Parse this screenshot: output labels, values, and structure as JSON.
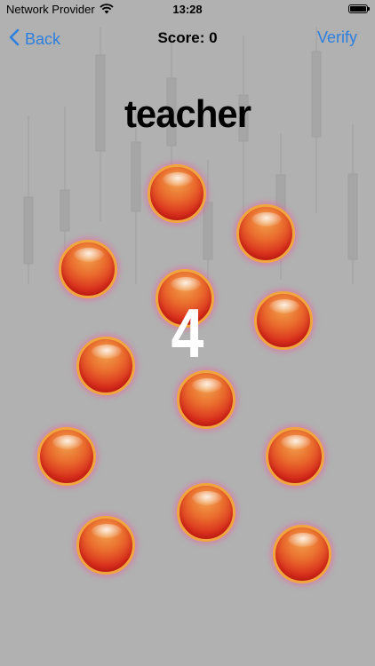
{
  "status_bar": {
    "carrier": "Network Provider",
    "time": "13:28",
    "wifi_icon": "wifi-icon",
    "battery_icon": "battery-icon"
  },
  "nav": {
    "back_label": "Back",
    "title": "Score: 0",
    "verify_label": "Verify",
    "accent_color": "#2d7fe0"
  },
  "game": {
    "word": "teacher",
    "countdown": "4",
    "orb_count": 12
  },
  "colors": {
    "background": "#b1b1b1",
    "orb_rim": "#f1a53f",
    "orb_core": "#d9301d"
  }
}
